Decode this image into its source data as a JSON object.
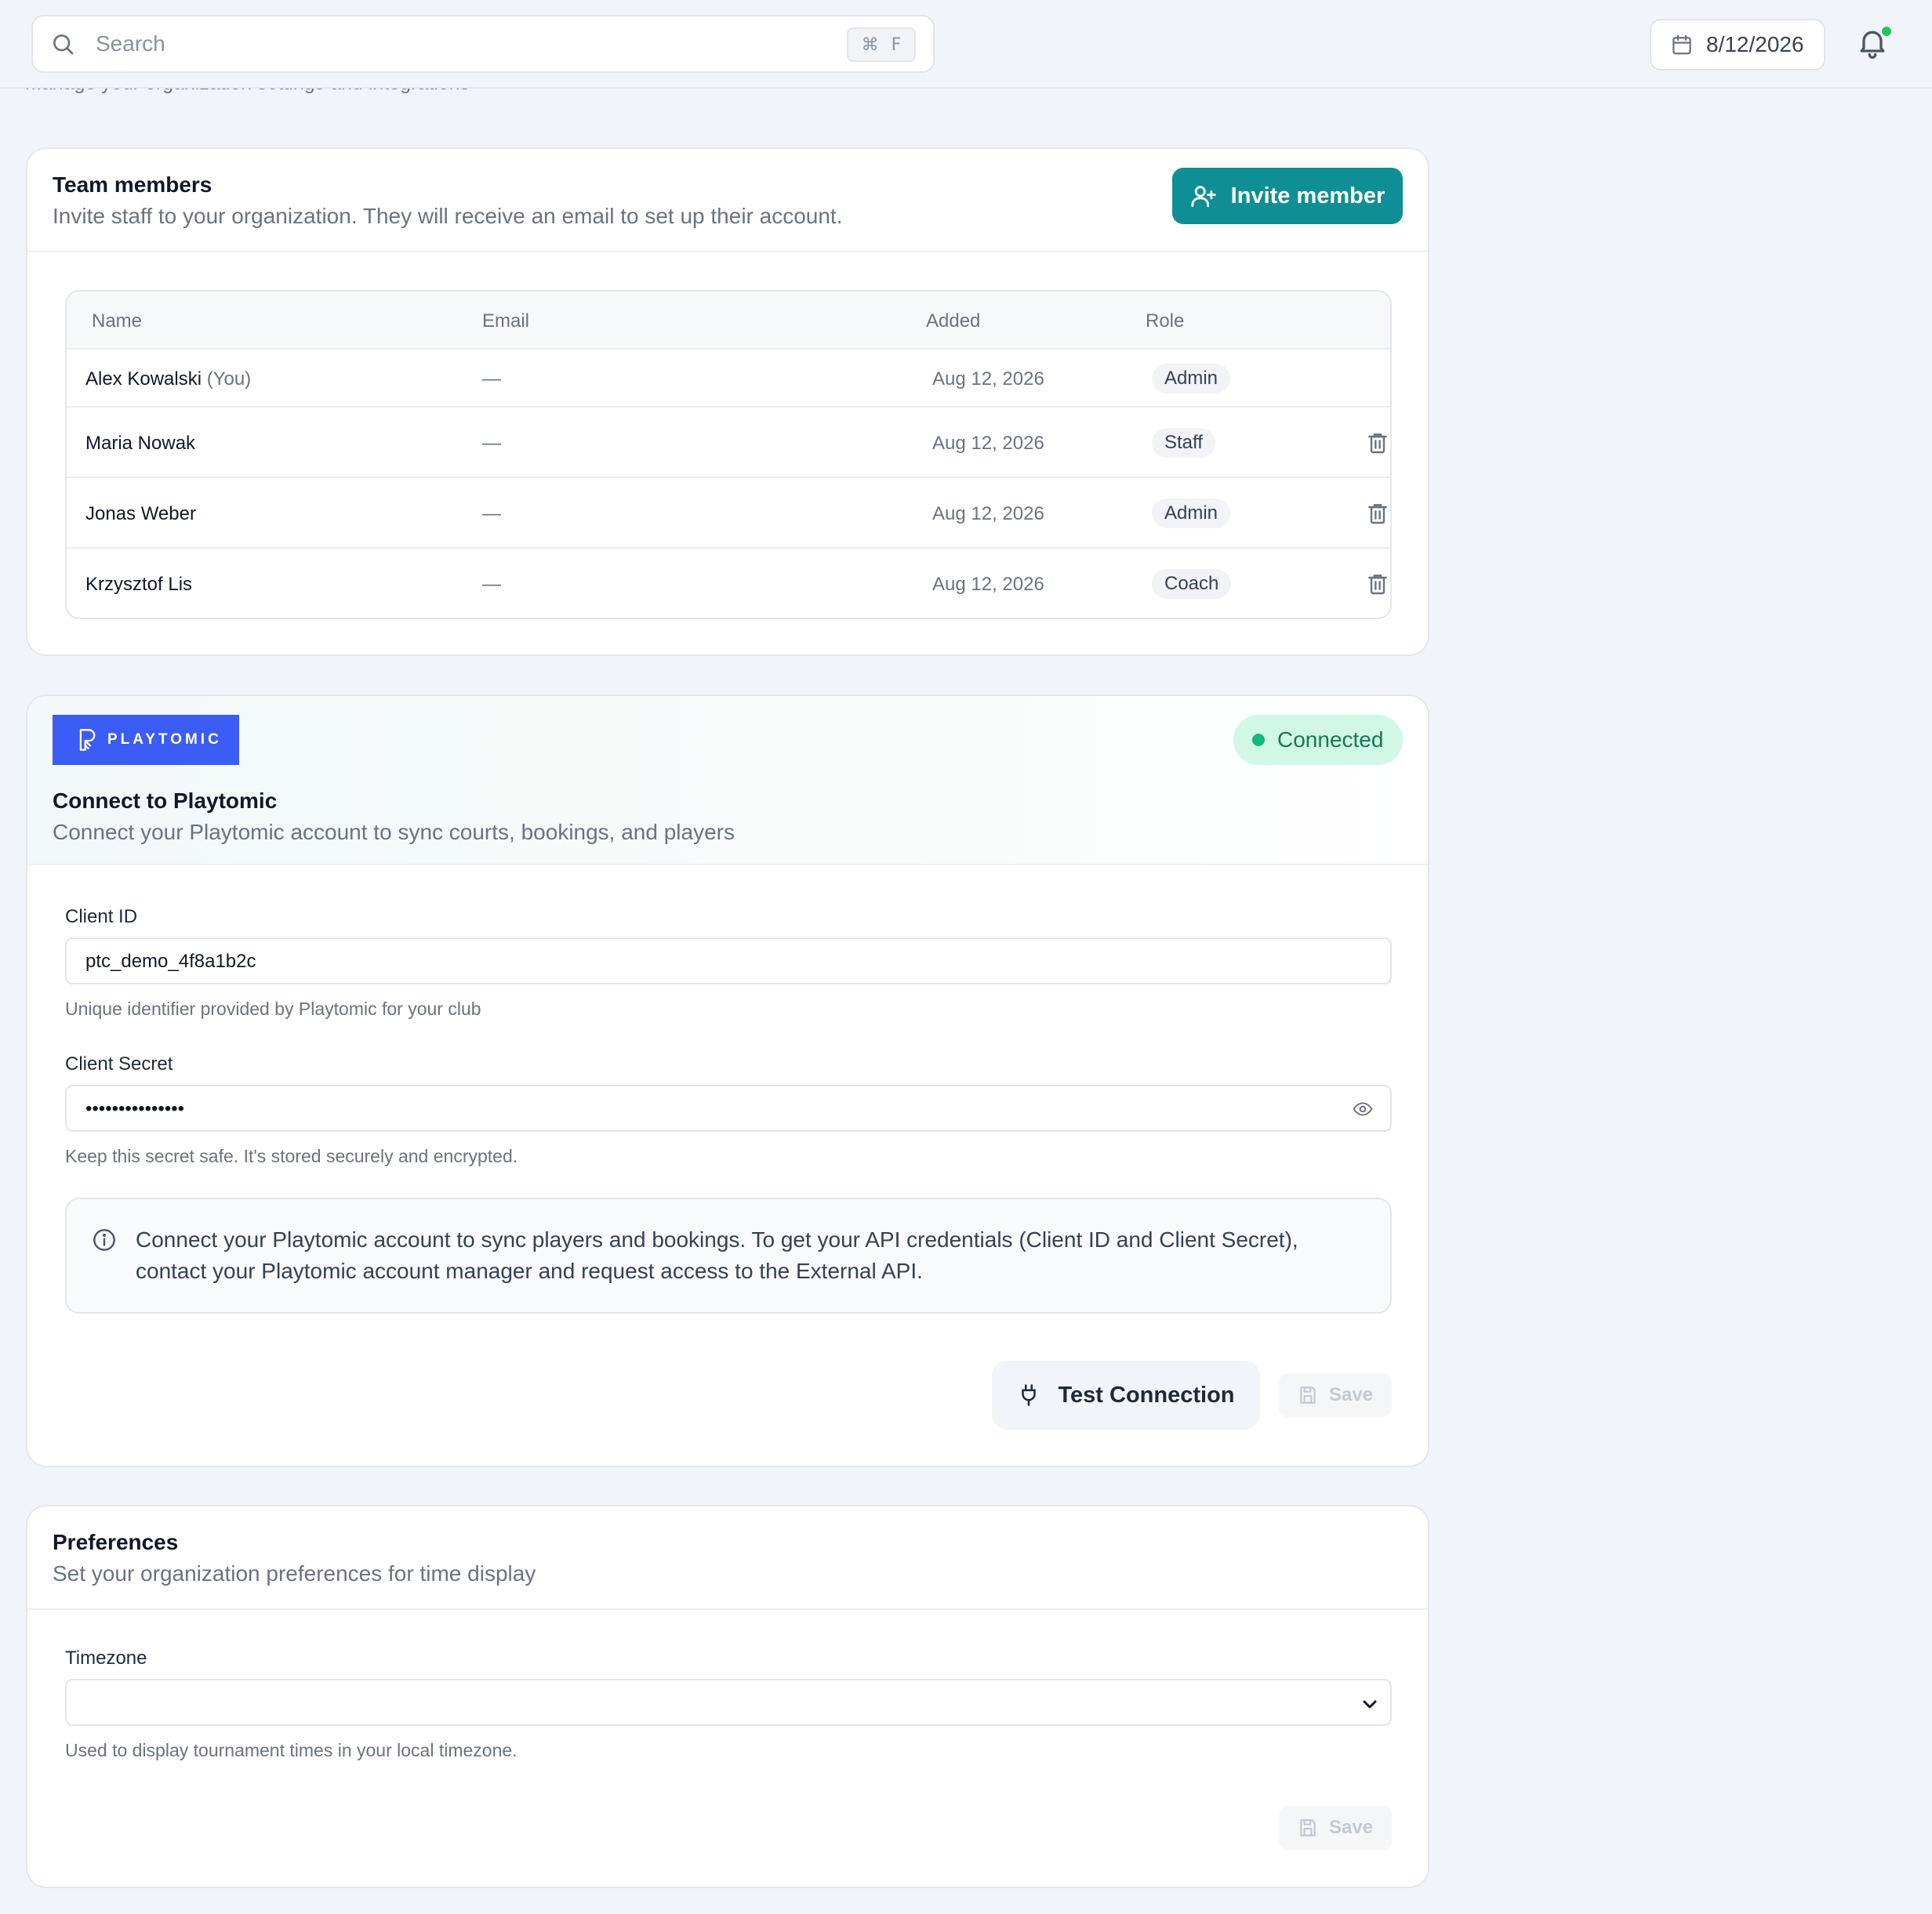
{
  "topbar": {
    "search_placeholder": "Search",
    "shortcut_symbol": "⌘",
    "shortcut_key": "F",
    "date": "8/12/2026"
  },
  "page": {
    "subtitle": "Manage your organization settings and integrations"
  },
  "team": {
    "title": "Team members",
    "description": "Invite staff to your organization. They will receive an email to set up their account.",
    "invite_label": "Invite member",
    "columns": [
      "Name",
      "Email",
      "Added",
      "Role"
    ],
    "you_suffix": "(You)",
    "rows": [
      {
        "name": "Alex Kowalski",
        "email": "—",
        "added": "Aug 12, 2026",
        "role": "Admin"
      },
      {
        "name": "Maria Nowak",
        "email": "—",
        "added": "Aug 12, 2026",
        "role": "Staff"
      },
      {
        "name": "Jonas Weber",
        "email": "—",
        "added": "Aug 12, 2026",
        "role": "Admin"
      },
      {
        "name": "Krzysztof Lis",
        "email": "—",
        "added": "Aug 12, 2026",
        "role": "Coach"
      }
    ]
  },
  "playtomic": {
    "logo_text": "PLAYTOMIC",
    "status": "Connected",
    "title": "Connect to Playtomic",
    "description": "Connect your Playtomic account to sync courts, bookings, and players",
    "client_id_label": "Client ID",
    "client_id_value": "ptc_demo_4f8a1b2c",
    "client_id_help": "Unique identifier provided by Playtomic for your club",
    "client_secret_label": "Client Secret",
    "client_secret_value": "•••••••••••••••",
    "client_secret_help": "Keep this secret safe. It's stored securely and encrypted.",
    "info_text": "Connect your Playtomic account to sync players and bookings. To get your API credentials (Client ID and Client Secret), contact your Playtomic account manager and request access to the External API.",
    "test_label": "Test Connection",
    "save_label": "Save"
  },
  "preferences": {
    "title": "Preferences",
    "description": "Set your organization preferences for time display",
    "timezone_label": "Timezone",
    "timezone_value": "",
    "timezone_help": "Used to display tournament times in your local timezone.",
    "save_label": "Save"
  },
  "colors": {
    "primary": "#0f8f95",
    "brand_playtomic": "#3b5cf5",
    "connected_bg": "#d1f7e6",
    "connected_text": "#107a55",
    "notification_dot": "#22c55e"
  },
  "icons": [
    "search-icon",
    "calendar-icon",
    "bell-icon",
    "user-plus-icon",
    "trash-icon",
    "playtomic-logo-icon",
    "eye-icon",
    "info-icon",
    "plug-icon",
    "save-icon",
    "chevron-down-icon"
  ]
}
